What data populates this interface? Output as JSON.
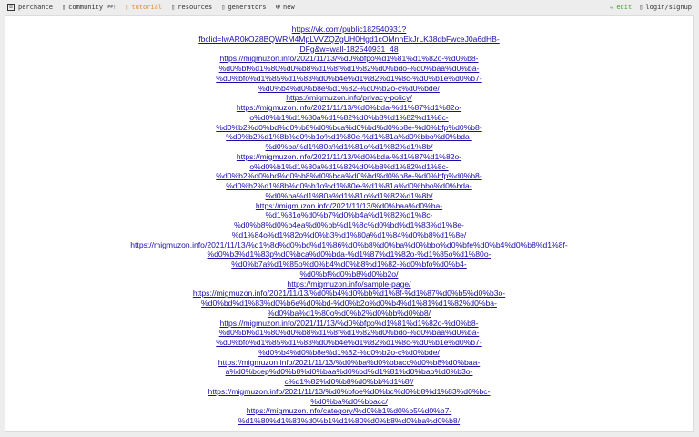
{
  "nav": {
    "logo_label": "perchance",
    "community_label": "community",
    "community_count": "(##)",
    "tutorial_label": "tutorial",
    "resources_label": "resources",
    "generators_label": "generators",
    "new_label": "new",
    "edit_label": "edit",
    "login_label": "login/signup",
    "icons": [
      "dice-icon",
      "people-icon",
      "book-icon",
      "folder-icon",
      "list-icon",
      "plus-icon",
      "pencil-icon",
      "user-icon"
    ]
  },
  "links": [
    {
      "lines": [
        "https://vk.com/public182540931?",
        "fbclid=IwAR0kOZ8BQWRM4MpLVVZQZgUH0Hgd1cOMnnEkJrLK38dbFwceJ0a6dHB-",
        "DFg&w=wall-182540931_48"
      ]
    },
    {
      "lines": [
        "https://migmuzon.info/2021/11/13/%d0%bfpo%d1%81%d1%82o-%d0%b8-",
        "%d0%bf%d1%80%d0%b8%d1%8f%d1%82%d0%bdo-%d0%baa%d0%ba-",
        "%d0%bfo%d1%85%d1%83%d0%b4e%d1%82%d1%8c-%d0%b1e%d0%b7-",
        "%d0%b4%d0%b8e%d1%82-%d0%b2o-c%d0%bde/"
      ]
    },
    {
      "lines": [
        "https://migmuzon.info/privacy-policy/"
      ]
    },
    {
      "lines": [
        "https://migmuzon.info/2021/11/13/%d0%bda-%d1%87%d1%82o-",
        "o%d0%b1%d1%80a%d1%82%d0%b8%d1%82%d1%8c-",
        "%d0%b2%d0%bd%d0%b8%d0%bca%d0%bd%d0%b8e-%d0%bfp%d0%b8-",
        "%d0%b2%d1%8b%d0%b1o%d1%80e-%d1%81a%d0%bbo%d0%bda-",
        "%d0%ba%d1%80a%d1%81o%d1%82%d1%8b/"
      ]
    },
    {
      "lines": [
        "https://migmuzon.info/2021/11/13/%d0%bda-%d1%87%d1%82o-",
        "o%d0%b1%d1%80a%d1%82%d0%b8%d1%82%d1%8c-",
        "%d0%b2%d0%bd%d0%b8%d0%bca%d0%bd%d0%b8e-%d0%bfp%d0%b8-",
        "%d0%b2%d1%8b%d0%b1o%d1%80e-%d1%81a%d0%bbo%d0%bda-",
        "%d0%ba%d1%80a%d1%81o%d1%82%d1%8b/"
      ]
    },
    {
      "lines": [
        "https://migmuzon.info/2021/11/13/%d0%baa%d0%ba-",
        "%d1%81o%d0%b7%d0%b4a%d1%82%d1%8c-",
        "%d0%b8%d0%b4ea%d0%bb%d1%8c%d0%bd%d1%83%d1%8e-",
        "%d1%84o%d1%82o%d0%b3%d1%80a%d1%84%d0%b8%d1%8e/"
      ]
    },
    {
      "lines": [
        "https://migmuzon.info/2021/11/13/%d1%8d%d0%bd%d1%86%d0%b8%d0%ba%d0%bbo%d0%bfe%d0%b4%d0%b8%d1%8f-",
        "%d0%b3%d1%83p%d0%bca%d0%bda-%d1%87%d1%82o-%d1%85o%d1%80o-",
        "%d0%b7a%d1%85o%d0%b4%d0%b8%d1%82-%d0%bfo%d0%b4-",
        "%d0%bf%d0%b8%d0%b2o/"
      ]
    },
    {
      "lines": [
        "https://migmuzon.info/sample-page/"
      ]
    },
    {
      "lines": [
        "https://migmuzon.info/2021/11/13/%d0%b4%d0%bb%d1%8f-%d1%87%d0%b5%d0%b3o-",
        "%d0%bd%d1%83%d0%b6e%d0%bd-%d0%b2o%d0%b4%d1%81%d1%82%d0%ba-",
        "%d0%ba%d1%80o%d0%b2%d0%bb%d0%b8/"
      ]
    },
    {
      "lines": [
        "https://migmuzon.info/2021/11/13/%d0%bfpo%d1%81%d1%82o-%d0%b8-",
        "%d0%bf%d1%80%d0%b8%d1%8f%d1%82%d0%bdo-%d0%baa%d0%ba-",
        "%d0%bfo%d1%85%d1%83%d0%b4e%d1%82%d1%8c-%d0%b1e%d0%b7-",
        "%d0%b4%d0%b8e%d1%82-%d0%b2o-c%d0%bde/"
      ]
    },
    {
      "lines": [
        "https://migmuzon.info/2021/11/13/%d0%ba%d0%bbacc%d0%b8%d0%baa-",
        "a%d0%bcep%d0%b8%d0%baa%d0%bd%d1%81%d0%bao%d0%b3o-",
        "c%d1%82%d0%b8%d0%bb%d1%8f/"
      ]
    },
    {
      "lines": [
        "https://migmuzon.info/2021/11/13/%d0%bfoe%d0%bc%d0%b8%d1%83%d0%bc-",
        "%d0%ba%d0%bbacc/"
      ]
    },
    {
      "lines": [
        "https://migmuzon.info/category/%d0%b1%d0%b5%d0%b7-",
        "%d1%80%d1%83%d0%b1%d1%80%d0%b8%d0%ba%d0%b8/"
      ]
    }
  ]
}
